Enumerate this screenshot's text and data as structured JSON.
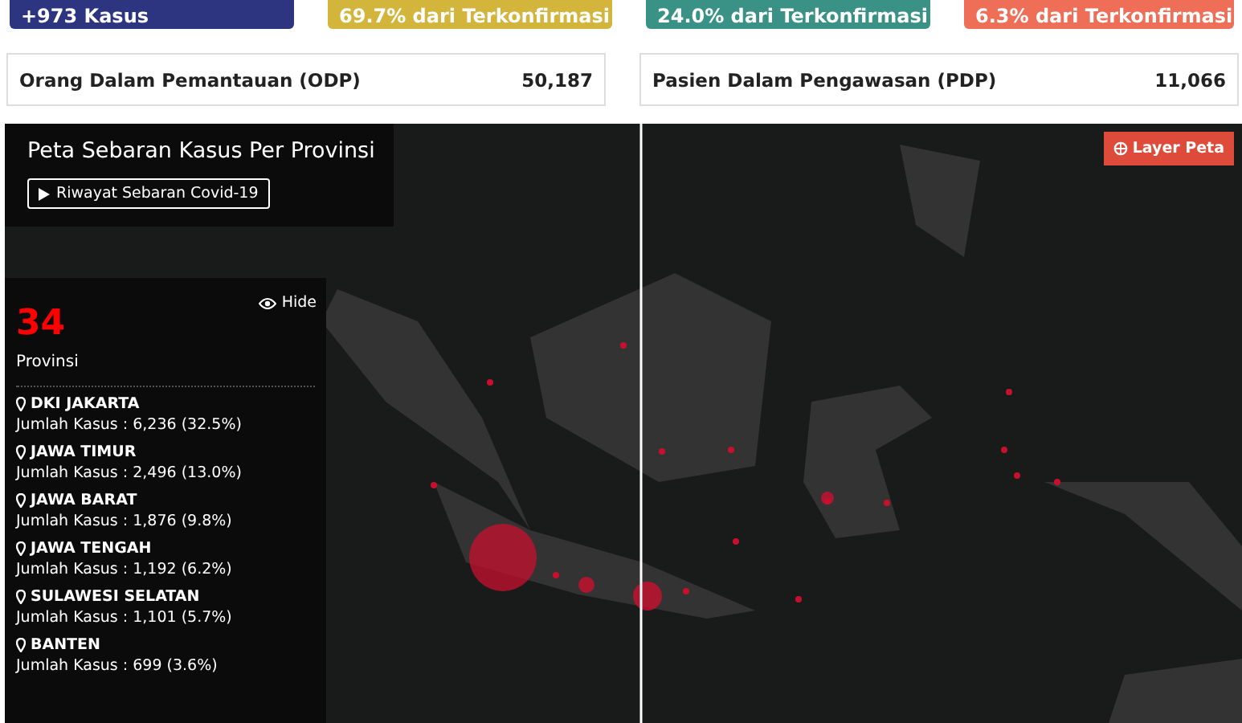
{
  "summary_cards": [
    {
      "text": "+973 Kasus",
      "color": "#2d3480"
    },
    {
      "text": "69.7% dari Terkonfirmasi",
      "color": "#d4b53c"
    },
    {
      "text": "24.0% dari Terkonfirmasi",
      "color": "#3a9186"
    },
    {
      "text": "6.3% dari Terkonfirmasi",
      "color": "#ee6e57"
    }
  ],
  "stats": [
    {
      "label": "Orang Dalam Pemantauan (ODP)",
      "value": "50,187"
    },
    {
      "label": "Pasien Dalam Pengawasan (PDP)",
      "value": "11,066"
    }
  ],
  "map": {
    "title": "Peta Sebaran Kasus Per Provinsi",
    "history_button": "Riwayat Sebaran Covid-19",
    "layer_button": "Layer Peta",
    "panel": {
      "count": "34",
      "count_label": "Provinsi",
      "hide_button": "Hide",
      "provinces": [
        {
          "name": "DKI JAKARTA",
          "cases": "Jumlah Kasus : 6,236 (32.5%)"
        },
        {
          "name": "JAWA TIMUR",
          "cases": "Jumlah Kasus : 2,496 (13.0%)"
        },
        {
          "name": "JAWA BARAT",
          "cases": "Jumlah Kasus : 1,876 (9.8%)"
        },
        {
          "name": "JAWA TENGAH",
          "cases": "Jumlah Kasus : 1,192 (6.2%)"
        },
        {
          "name": "SULAWESI SELATAN",
          "cases": "Jumlah Kasus : 1,101 (5.7%)"
        },
        {
          "name": "BANTEN",
          "cases": "Jumlah Kasus : 699 (3.6%)"
        }
      ]
    }
  }
}
